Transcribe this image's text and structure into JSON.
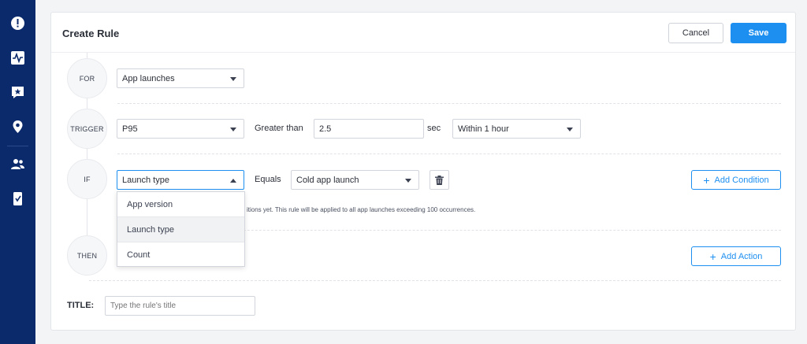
{
  "sidebar": {
    "icons": [
      "alert-icon",
      "activity-icon",
      "feedback-star-icon",
      "location-pin-icon",
      "users-icon",
      "mobile-device-icon"
    ]
  },
  "header": {
    "title": "Create Rule",
    "cancel_label": "Cancel",
    "save_label": "Save"
  },
  "steps": {
    "for": {
      "label": "FOR",
      "select_value": "App launches"
    },
    "trigger": {
      "label": "TRIGGER",
      "metric_value": "P95",
      "operator_text": "Greater than",
      "threshold_value": "2.5",
      "unit_text": "sec",
      "window_value": "Within 1 hour"
    },
    "if": {
      "label": "IF",
      "field_value": "Launch type",
      "operator_text": "Equals",
      "value_select": "Cold app launch",
      "add_condition_label": "Add Condition",
      "note_text": "itions yet. This rule will be applied to all app launches exceeding 100 occurrences.",
      "dropdown_options": [
        "App version",
        "Launch type",
        "Count"
      ]
    },
    "then": {
      "label": "THEN",
      "add_action_label": "Add Action"
    }
  },
  "title_field": {
    "label": "TITLE:",
    "placeholder": "Type the rule's title"
  },
  "colors": {
    "sidebar": "#0b2a6b",
    "accent": "#1d8ff0"
  }
}
